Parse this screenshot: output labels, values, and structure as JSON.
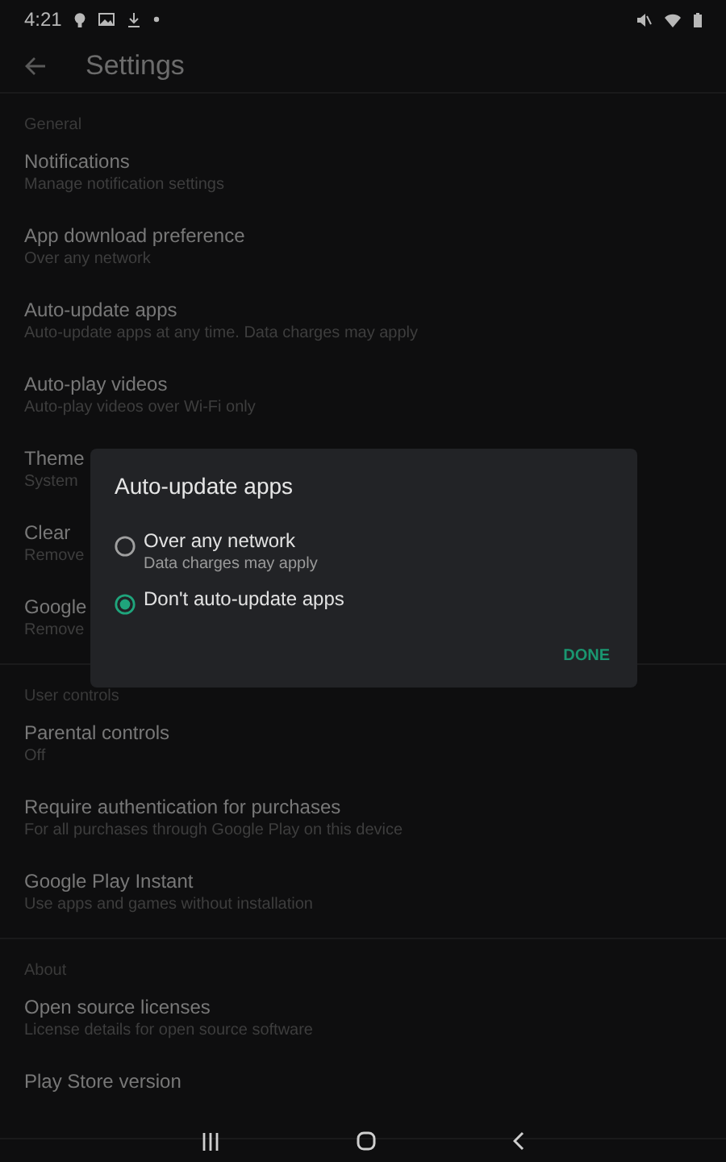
{
  "status_bar": {
    "time": "4:21"
  },
  "header": {
    "title": "Settings"
  },
  "sections": [
    {
      "heading": "General",
      "items": [
        {
          "title": "Notifications",
          "subtitle": "Manage notification settings"
        },
        {
          "title": "App download preference",
          "subtitle": "Over any network"
        },
        {
          "title": "Auto-update apps",
          "subtitle": "Auto-update apps at any time. Data charges may apply"
        },
        {
          "title": "Auto-play videos",
          "subtitle": "Auto-play videos over Wi-Fi only"
        },
        {
          "title": "Theme",
          "subtitle": "System"
        },
        {
          "title": "Clear",
          "subtitle": "Remove"
        },
        {
          "title": "Google",
          "subtitle": "Remove"
        }
      ]
    },
    {
      "heading": "User controls",
      "items": [
        {
          "title": "Parental controls",
          "subtitle": "Off"
        },
        {
          "title": "Require authentication for purchases",
          "subtitle": "For all purchases through Google Play on this device"
        },
        {
          "title": "Google Play Instant",
          "subtitle": "Use apps and games without installation"
        }
      ]
    },
    {
      "heading": "About",
      "items": [
        {
          "title": "Open source licenses",
          "subtitle": "License details for open source software"
        },
        {
          "title": "Play Store version"
        }
      ]
    }
  ],
  "dialog": {
    "title": "Auto-update apps",
    "options": [
      {
        "label": "Over any network",
        "sublabel": "Data charges may apply",
        "selected": false
      },
      {
        "label": "Don't auto-update apps",
        "selected": true
      }
    ],
    "button": "DONE"
  }
}
